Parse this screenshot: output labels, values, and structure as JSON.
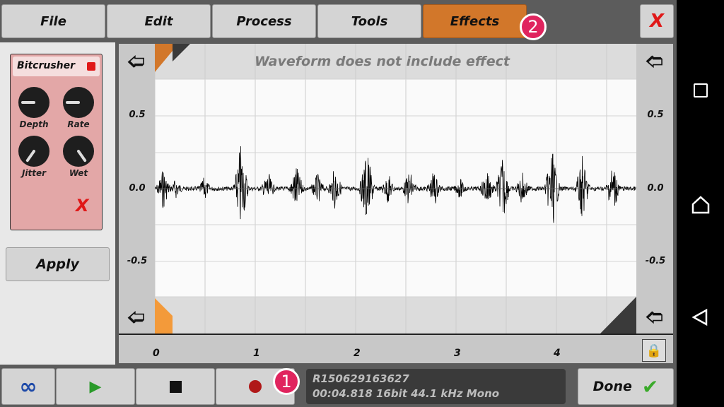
{
  "menu": {
    "file": "File",
    "edit": "Edit",
    "process": "Process",
    "tools": "Tools",
    "effects": "Effects",
    "close": "X"
  },
  "badges": {
    "one": "1",
    "two": "2"
  },
  "effect": {
    "name": "Bitcrusher",
    "knobs": [
      {
        "label": "Depth",
        "angle": -90
      },
      {
        "label": "Rate",
        "angle": -90
      },
      {
        "label": "Jitter",
        "angle": -145
      },
      {
        "label": "Wet",
        "angle": 145
      }
    ],
    "remove": "X",
    "apply": "Apply"
  },
  "waveform": {
    "notice": "Waveform does not include effect",
    "y_ticks": [
      "0.5",
      "0.0",
      "-0.5"
    ],
    "x_ticks": [
      "0",
      "1",
      "2",
      "3",
      "4"
    ]
  },
  "info": {
    "name": "R150629163627",
    "details": "00:04.818 16bit 44.1 kHz Mono"
  },
  "transport": {
    "done": "Done"
  },
  "colors": {
    "accent": "#d2772a",
    "record": "#b01818",
    "play": "#2a9a2a",
    "effect_panel": "#e3a7a7"
  }
}
